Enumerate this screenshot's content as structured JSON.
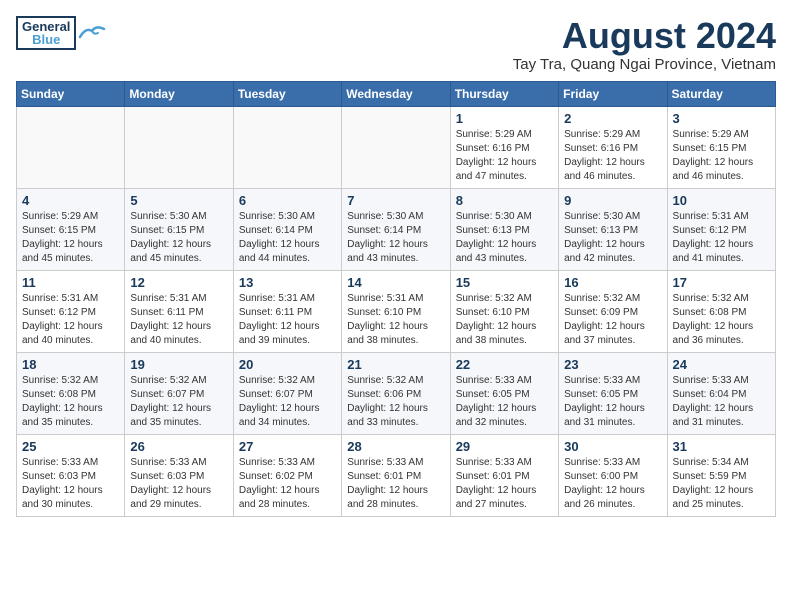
{
  "header": {
    "logo_general": "General",
    "logo_blue": "Blue",
    "main_title": "August 2024",
    "subtitle": "Tay Tra, Quang Ngai Province, Vietnam"
  },
  "weekdays": [
    "Sunday",
    "Monday",
    "Tuesday",
    "Wednesday",
    "Thursday",
    "Friday",
    "Saturday"
  ],
  "weeks": [
    [
      {
        "day": "",
        "info": ""
      },
      {
        "day": "",
        "info": ""
      },
      {
        "day": "",
        "info": ""
      },
      {
        "day": "",
        "info": ""
      },
      {
        "day": "1",
        "info": "Sunrise: 5:29 AM\nSunset: 6:16 PM\nDaylight: 12 hours\nand 47 minutes."
      },
      {
        "day": "2",
        "info": "Sunrise: 5:29 AM\nSunset: 6:16 PM\nDaylight: 12 hours\nand 46 minutes."
      },
      {
        "day": "3",
        "info": "Sunrise: 5:29 AM\nSunset: 6:15 PM\nDaylight: 12 hours\nand 46 minutes."
      }
    ],
    [
      {
        "day": "4",
        "info": "Sunrise: 5:29 AM\nSunset: 6:15 PM\nDaylight: 12 hours\nand 45 minutes."
      },
      {
        "day": "5",
        "info": "Sunrise: 5:30 AM\nSunset: 6:15 PM\nDaylight: 12 hours\nand 45 minutes."
      },
      {
        "day": "6",
        "info": "Sunrise: 5:30 AM\nSunset: 6:14 PM\nDaylight: 12 hours\nand 44 minutes."
      },
      {
        "day": "7",
        "info": "Sunrise: 5:30 AM\nSunset: 6:14 PM\nDaylight: 12 hours\nand 43 minutes."
      },
      {
        "day": "8",
        "info": "Sunrise: 5:30 AM\nSunset: 6:13 PM\nDaylight: 12 hours\nand 43 minutes."
      },
      {
        "day": "9",
        "info": "Sunrise: 5:30 AM\nSunset: 6:13 PM\nDaylight: 12 hours\nand 42 minutes."
      },
      {
        "day": "10",
        "info": "Sunrise: 5:31 AM\nSunset: 6:12 PM\nDaylight: 12 hours\nand 41 minutes."
      }
    ],
    [
      {
        "day": "11",
        "info": "Sunrise: 5:31 AM\nSunset: 6:12 PM\nDaylight: 12 hours\nand 40 minutes."
      },
      {
        "day": "12",
        "info": "Sunrise: 5:31 AM\nSunset: 6:11 PM\nDaylight: 12 hours\nand 40 minutes."
      },
      {
        "day": "13",
        "info": "Sunrise: 5:31 AM\nSunset: 6:11 PM\nDaylight: 12 hours\nand 39 minutes."
      },
      {
        "day": "14",
        "info": "Sunrise: 5:31 AM\nSunset: 6:10 PM\nDaylight: 12 hours\nand 38 minutes."
      },
      {
        "day": "15",
        "info": "Sunrise: 5:32 AM\nSunset: 6:10 PM\nDaylight: 12 hours\nand 38 minutes."
      },
      {
        "day": "16",
        "info": "Sunrise: 5:32 AM\nSunset: 6:09 PM\nDaylight: 12 hours\nand 37 minutes."
      },
      {
        "day": "17",
        "info": "Sunrise: 5:32 AM\nSunset: 6:08 PM\nDaylight: 12 hours\nand 36 minutes."
      }
    ],
    [
      {
        "day": "18",
        "info": "Sunrise: 5:32 AM\nSunset: 6:08 PM\nDaylight: 12 hours\nand 35 minutes."
      },
      {
        "day": "19",
        "info": "Sunrise: 5:32 AM\nSunset: 6:07 PM\nDaylight: 12 hours\nand 35 minutes."
      },
      {
        "day": "20",
        "info": "Sunrise: 5:32 AM\nSunset: 6:07 PM\nDaylight: 12 hours\nand 34 minutes."
      },
      {
        "day": "21",
        "info": "Sunrise: 5:32 AM\nSunset: 6:06 PM\nDaylight: 12 hours\nand 33 minutes."
      },
      {
        "day": "22",
        "info": "Sunrise: 5:33 AM\nSunset: 6:05 PM\nDaylight: 12 hours\nand 32 minutes."
      },
      {
        "day": "23",
        "info": "Sunrise: 5:33 AM\nSunset: 6:05 PM\nDaylight: 12 hours\nand 31 minutes."
      },
      {
        "day": "24",
        "info": "Sunrise: 5:33 AM\nSunset: 6:04 PM\nDaylight: 12 hours\nand 31 minutes."
      }
    ],
    [
      {
        "day": "25",
        "info": "Sunrise: 5:33 AM\nSunset: 6:03 PM\nDaylight: 12 hours\nand 30 minutes."
      },
      {
        "day": "26",
        "info": "Sunrise: 5:33 AM\nSunset: 6:03 PM\nDaylight: 12 hours\nand 29 minutes."
      },
      {
        "day": "27",
        "info": "Sunrise: 5:33 AM\nSunset: 6:02 PM\nDaylight: 12 hours\nand 28 minutes."
      },
      {
        "day": "28",
        "info": "Sunrise: 5:33 AM\nSunset: 6:01 PM\nDaylight: 12 hours\nand 28 minutes."
      },
      {
        "day": "29",
        "info": "Sunrise: 5:33 AM\nSunset: 6:01 PM\nDaylight: 12 hours\nand 27 minutes."
      },
      {
        "day": "30",
        "info": "Sunrise: 5:33 AM\nSunset: 6:00 PM\nDaylight: 12 hours\nand 26 minutes."
      },
      {
        "day": "31",
        "info": "Sunrise: 5:34 AM\nSunset: 5:59 PM\nDaylight: 12 hours\nand 25 minutes."
      }
    ]
  ]
}
